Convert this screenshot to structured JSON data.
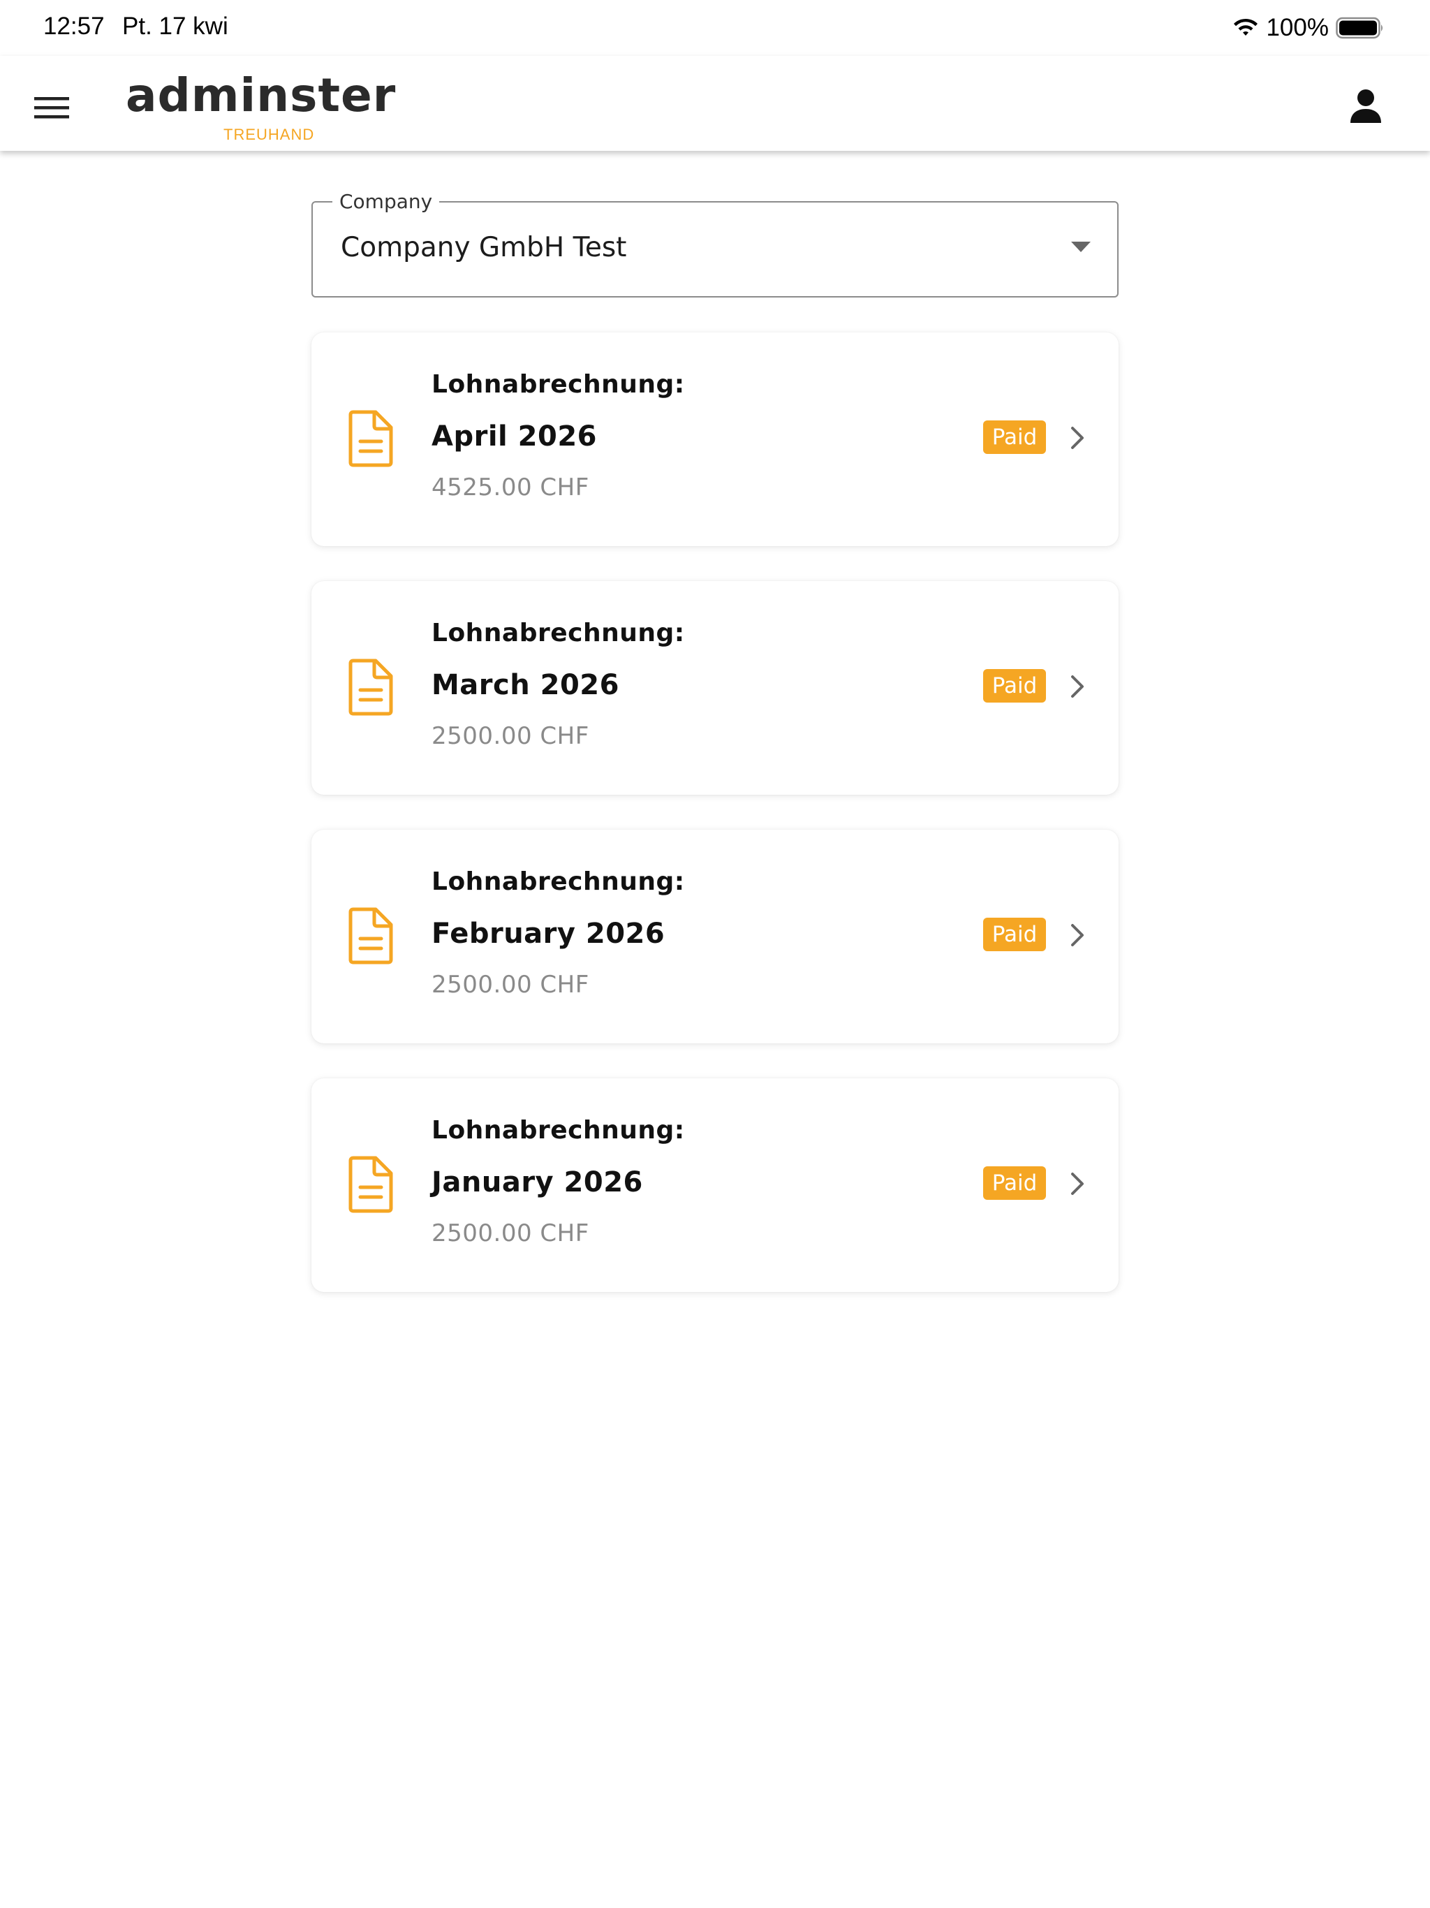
{
  "status_bar": {
    "time": "12:57",
    "date": "Pt. 17 kwi",
    "battery": "100%"
  },
  "app_bar": {
    "logo_text": "adminster",
    "logo_subtext": "TREUHAND"
  },
  "company_select": {
    "label": "Company",
    "value": "Company GmbH Test"
  },
  "payslips": [
    {
      "title": "Lohnabrechnung:",
      "period": "April 2026",
      "amount": "4525.00 CHF",
      "status": "Paid"
    },
    {
      "title": "Lohnabrechnung:",
      "period": "March 2026",
      "amount": "2500.00 CHF",
      "status": "Paid"
    },
    {
      "title": "Lohnabrechnung:",
      "period": "February 2026",
      "amount": "2500.00 CHF",
      "status": "Paid"
    },
    {
      "title": "Lohnabrechnung:",
      "period": "January 2026",
      "amount": "2500.00 CHF",
      "status": "Paid"
    }
  ],
  "colors": {
    "accent": "#f5a623",
    "text_primary": "#111111",
    "text_secondary": "#8a8a8a"
  },
  "icons": {
    "menu": "hamburger-menu-icon",
    "profile": "person-icon",
    "document": "document-icon",
    "chevron": "chevron-right-icon",
    "dropdown": "caret-down-icon",
    "wifi": "wifi-icon",
    "battery": "battery-icon"
  }
}
